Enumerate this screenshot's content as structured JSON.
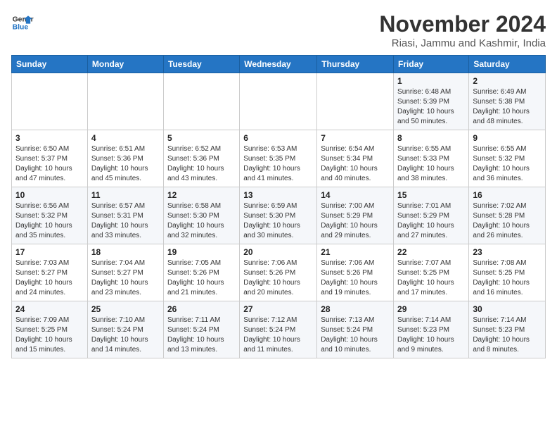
{
  "header": {
    "logo_line1": "General",
    "logo_line2": "Blue",
    "month_title": "November 2024",
    "subtitle": "Riasi, Jammu and Kashmir, India"
  },
  "days_of_week": [
    "Sunday",
    "Monday",
    "Tuesday",
    "Wednesday",
    "Thursday",
    "Friday",
    "Saturday"
  ],
  "weeks": [
    [
      {
        "day": "",
        "info": ""
      },
      {
        "day": "",
        "info": ""
      },
      {
        "day": "",
        "info": ""
      },
      {
        "day": "",
        "info": ""
      },
      {
        "day": "",
        "info": ""
      },
      {
        "day": "1",
        "info": "Sunrise: 6:48 AM\nSunset: 5:39 PM\nDaylight: 10 hours\nand 50 minutes."
      },
      {
        "day": "2",
        "info": "Sunrise: 6:49 AM\nSunset: 5:38 PM\nDaylight: 10 hours\nand 48 minutes."
      }
    ],
    [
      {
        "day": "3",
        "info": "Sunrise: 6:50 AM\nSunset: 5:37 PM\nDaylight: 10 hours\nand 47 minutes."
      },
      {
        "day": "4",
        "info": "Sunrise: 6:51 AM\nSunset: 5:36 PM\nDaylight: 10 hours\nand 45 minutes."
      },
      {
        "day": "5",
        "info": "Sunrise: 6:52 AM\nSunset: 5:36 PM\nDaylight: 10 hours\nand 43 minutes."
      },
      {
        "day": "6",
        "info": "Sunrise: 6:53 AM\nSunset: 5:35 PM\nDaylight: 10 hours\nand 41 minutes."
      },
      {
        "day": "7",
        "info": "Sunrise: 6:54 AM\nSunset: 5:34 PM\nDaylight: 10 hours\nand 40 minutes."
      },
      {
        "day": "8",
        "info": "Sunrise: 6:55 AM\nSunset: 5:33 PM\nDaylight: 10 hours\nand 38 minutes."
      },
      {
        "day": "9",
        "info": "Sunrise: 6:55 AM\nSunset: 5:32 PM\nDaylight: 10 hours\nand 36 minutes."
      }
    ],
    [
      {
        "day": "10",
        "info": "Sunrise: 6:56 AM\nSunset: 5:32 PM\nDaylight: 10 hours\nand 35 minutes."
      },
      {
        "day": "11",
        "info": "Sunrise: 6:57 AM\nSunset: 5:31 PM\nDaylight: 10 hours\nand 33 minutes."
      },
      {
        "day": "12",
        "info": "Sunrise: 6:58 AM\nSunset: 5:30 PM\nDaylight: 10 hours\nand 32 minutes."
      },
      {
        "day": "13",
        "info": "Sunrise: 6:59 AM\nSunset: 5:30 PM\nDaylight: 10 hours\nand 30 minutes."
      },
      {
        "day": "14",
        "info": "Sunrise: 7:00 AM\nSunset: 5:29 PM\nDaylight: 10 hours\nand 29 minutes."
      },
      {
        "day": "15",
        "info": "Sunrise: 7:01 AM\nSunset: 5:29 PM\nDaylight: 10 hours\nand 27 minutes."
      },
      {
        "day": "16",
        "info": "Sunrise: 7:02 AM\nSunset: 5:28 PM\nDaylight: 10 hours\nand 26 minutes."
      }
    ],
    [
      {
        "day": "17",
        "info": "Sunrise: 7:03 AM\nSunset: 5:27 PM\nDaylight: 10 hours\nand 24 minutes."
      },
      {
        "day": "18",
        "info": "Sunrise: 7:04 AM\nSunset: 5:27 PM\nDaylight: 10 hours\nand 23 minutes."
      },
      {
        "day": "19",
        "info": "Sunrise: 7:05 AM\nSunset: 5:26 PM\nDaylight: 10 hours\nand 21 minutes."
      },
      {
        "day": "20",
        "info": "Sunrise: 7:06 AM\nSunset: 5:26 PM\nDaylight: 10 hours\nand 20 minutes."
      },
      {
        "day": "21",
        "info": "Sunrise: 7:06 AM\nSunset: 5:26 PM\nDaylight: 10 hours\nand 19 minutes."
      },
      {
        "day": "22",
        "info": "Sunrise: 7:07 AM\nSunset: 5:25 PM\nDaylight: 10 hours\nand 17 minutes."
      },
      {
        "day": "23",
        "info": "Sunrise: 7:08 AM\nSunset: 5:25 PM\nDaylight: 10 hours\nand 16 minutes."
      }
    ],
    [
      {
        "day": "24",
        "info": "Sunrise: 7:09 AM\nSunset: 5:25 PM\nDaylight: 10 hours\nand 15 minutes."
      },
      {
        "day": "25",
        "info": "Sunrise: 7:10 AM\nSunset: 5:24 PM\nDaylight: 10 hours\nand 14 minutes."
      },
      {
        "day": "26",
        "info": "Sunrise: 7:11 AM\nSunset: 5:24 PM\nDaylight: 10 hours\nand 13 minutes."
      },
      {
        "day": "27",
        "info": "Sunrise: 7:12 AM\nSunset: 5:24 PM\nDaylight: 10 hours\nand 11 minutes."
      },
      {
        "day": "28",
        "info": "Sunrise: 7:13 AM\nSunset: 5:24 PM\nDaylight: 10 hours\nand 10 minutes."
      },
      {
        "day": "29",
        "info": "Sunrise: 7:14 AM\nSunset: 5:23 PM\nDaylight: 10 hours\nand 9 minutes."
      },
      {
        "day": "30",
        "info": "Sunrise: 7:14 AM\nSunset: 5:23 PM\nDaylight: 10 hours\nand 8 minutes."
      }
    ]
  ]
}
